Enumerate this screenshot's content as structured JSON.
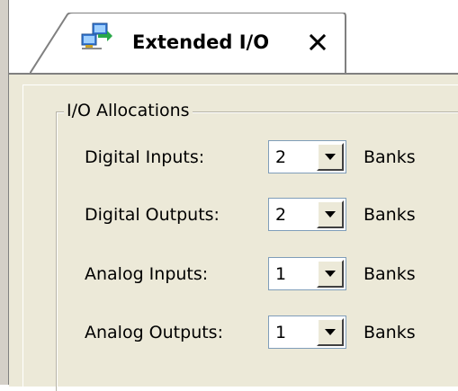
{
  "tab": {
    "title": "Extended I/O",
    "icon": "network-computers-icon",
    "close_glyph": "×"
  },
  "group": {
    "legend": "I/O Allocations"
  },
  "rows": [
    {
      "label": "Digital Inputs:",
      "value": "2",
      "unit": "Banks"
    },
    {
      "label": "Digital Outputs:",
      "value": "2",
      "unit": "Banks"
    },
    {
      "label": "Analog Inputs:",
      "value": "1",
      "unit": "Banks"
    },
    {
      "label": "Analog Outputs:",
      "value": "1",
      "unit": "Banks"
    }
  ],
  "colors": {
    "panel": "#ece9d8",
    "tab_bg": "#ffffff",
    "combo_border": "#7f9db9"
  }
}
